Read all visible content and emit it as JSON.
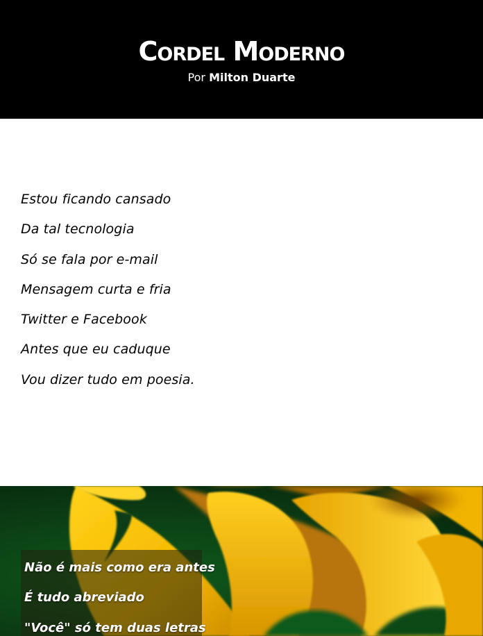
{
  "header": {
    "title": "Cordel Moderno",
    "byline_prefix": "Por",
    "author": "Milton Duarte",
    "background": "#000000"
  },
  "poem": {
    "verses": [
      "Estou ficando cansado",
      "Da tal tecnologia",
      "Só se fala por e-mail",
      "Mensagem curta e fria",
      "Twitter e Facebook",
      "Antes que eu caduque",
      "Vou dizer tudo em poesia."
    ]
  },
  "photo": {
    "image": "yellow-flower-photo",
    "caption_lines": [
      "Não é mais como era antes",
      "É tudo abreviado",
      "\"Você\" só tem duas letras"
    ]
  }
}
